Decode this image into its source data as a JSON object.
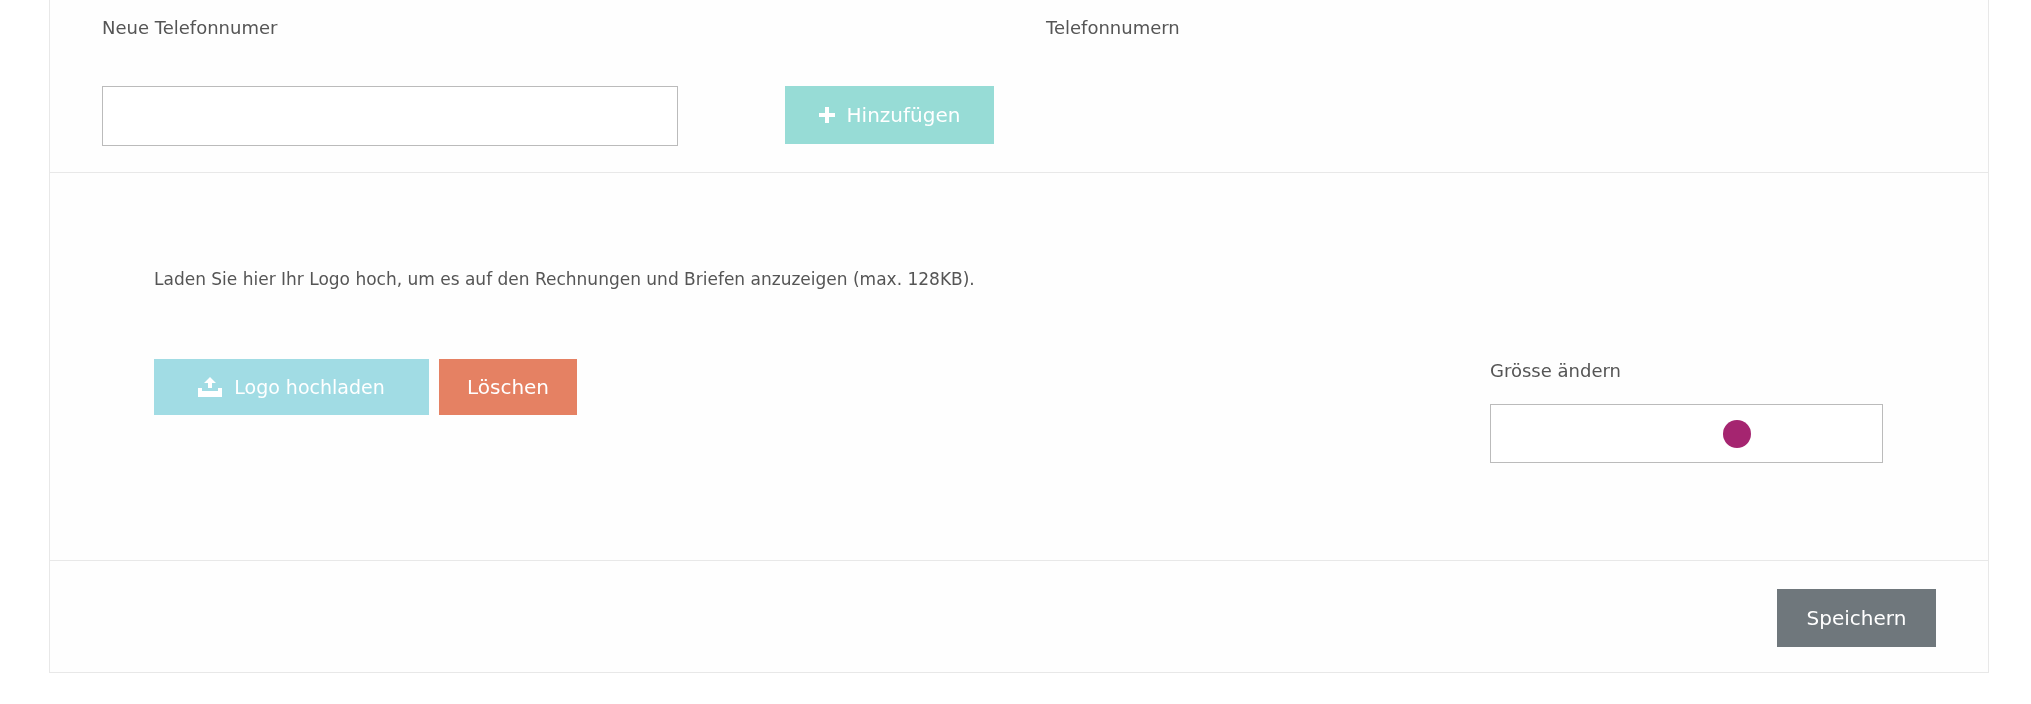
{
  "phone": {
    "new_label": "Neue Telefonnumer",
    "add_button": "Hinzufügen",
    "list_label": "Telefonnumern"
  },
  "logo": {
    "description": "Laden Sie hier Ihr Logo hoch, um es auf den Rechnungen und Briefen anzuzeigen (max. 128KB).",
    "upload_button": "Logo hochladen",
    "delete_button": "Löschen",
    "resize": {
      "label": "Grösse ändern",
      "level": 0.63
    }
  },
  "footer": {
    "save_button": "Speichern"
  }
}
